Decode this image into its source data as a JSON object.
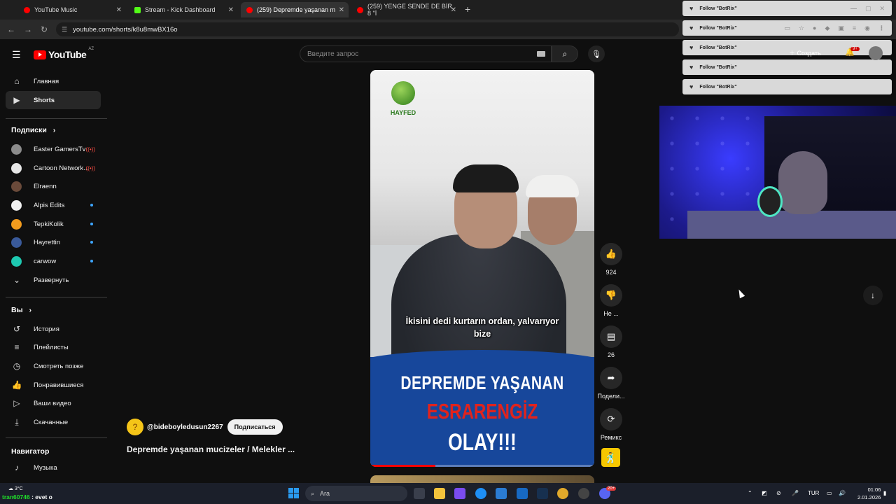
{
  "browser": {
    "tabs": [
      {
        "title": "YouTube Music",
        "color": "#ff0000"
      },
      {
        "title": "Stream - Kick Dashboard",
        "color": "#53fc18"
      },
      {
        "title": "(259) Depremde yaşanan m",
        "color": "#ff0000"
      },
      {
        "title": "(259) YENGE SENDE DE BİR 8 \"İ",
        "color": "#ff0000"
      }
    ],
    "url": "youtube.com/shorts/k8u8mwBX16o"
  },
  "notifications": {
    "items": [
      "Follow \"BotRix\"",
      "Follow \"BotRix\"",
      "Follow \"BotRix\"",
      "Follow \"BotRix\"",
      "Follow \"BotRix\""
    ]
  },
  "header": {
    "logo_text": "YouTube",
    "logo_region": "AZ",
    "search_placeholder": "Введите запрос",
    "create_label": "Создать",
    "notif_badge": "9+"
  },
  "sidebar": {
    "main": [
      {
        "label": "Главная",
        "icon": "home-icon"
      },
      {
        "label": "Shorts",
        "icon": "shorts-icon"
      }
    ],
    "subs_title": "Подписки",
    "subs": [
      {
        "label": "Easter GamersTv",
        "color": "#8b8b8b",
        "status": "live"
      },
      {
        "label": "Cartoon Network...",
        "color": "#e6e6e6",
        "status": "live"
      },
      {
        "label": "Elraenn",
        "color": "#6a4a3a",
        "status": ""
      },
      {
        "label": "Alpis Edits",
        "color": "#f0f0f0",
        "status": "new"
      },
      {
        "label": "TepkiKolik",
        "color": "#f29b1d",
        "status": "new"
      },
      {
        "label": "Hayrettin",
        "color": "#3a5a9a",
        "status": "new"
      },
      {
        "label": "carwow",
        "color": "#1ec8b0",
        "status": "new"
      }
    ],
    "expand_label": "Развернуть",
    "you_title": "Вы",
    "you": [
      {
        "label": "История",
        "icon": "history-icon"
      },
      {
        "label": "Плейлисты",
        "icon": "playlists-icon"
      },
      {
        "label": "Смотреть позже",
        "icon": "watch-later-icon"
      },
      {
        "label": "Понравившиеся",
        "icon": "liked-icon"
      },
      {
        "label": "Ваши видео",
        "icon": "your-videos-icon"
      },
      {
        "label": "Скачанные",
        "icon": "downloads-icon"
      }
    ],
    "nav_title": "Навигатор",
    "nav": [
      {
        "label": "Музыка",
        "icon": "music-icon"
      }
    ]
  },
  "short": {
    "watermark": "HAYFED",
    "subtitle_line1": "İkisini dedi kurtarın ordan, yalvarıyor",
    "subtitle_line2": "bize",
    "banner_line1": "DEPREMDE YAŞANAN",
    "banner_line2": "ESRARENGİZ",
    "banner_line3": "OLAY!!!",
    "progress": 0.29,
    "channel_name": "@bideboyledusun2267",
    "subscribe_label": "Подписаться",
    "video_title": "Depremde yaşanan mucizeler / Melekler ..."
  },
  "actions": {
    "likes": "924",
    "dislike_label": "Не ...",
    "comments": "26",
    "share_label": "Подели...",
    "remix_label": "Ремикс"
  },
  "taskbar": {
    "weather_temp": "3°C",
    "chat_user": "tran60746",
    "chat_text": ": evet o",
    "search_label": "Ara",
    "lang": "TUR",
    "time": "01:06",
    "date": "2.01.2026",
    "discord_badge": "20+"
  }
}
